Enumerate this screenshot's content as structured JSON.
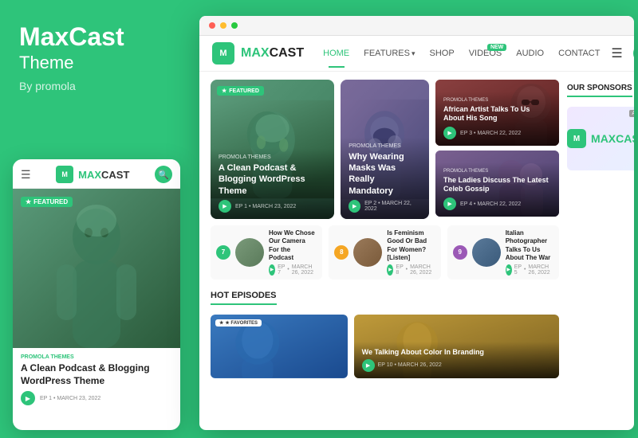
{
  "brand": {
    "name": "MaxCast",
    "subtitle": "Theme",
    "by": "By promola"
  },
  "nav": {
    "logo": "MAXCAST",
    "logo_max": "MAX",
    "logo_cast": "CAST",
    "links": [
      {
        "label": "HOME",
        "active": true
      },
      {
        "label": "FEATURES",
        "has_dropdown": true,
        "active": false
      },
      {
        "label": "SHOP",
        "active": false
      },
      {
        "label": "VIDEOS",
        "badge": "NEW",
        "active": false
      },
      {
        "label": "AUDIO",
        "active": false
      },
      {
        "label": "CONTACT",
        "active": false
      }
    ]
  },
  "featured_card1": {
    "tag": "PROMOLA THEMES",
    "title": "A Clean Podcast & Blogging WordPress Theme",
    "ep": "EP 1",
    "date": "MARCH 23, 2022",
    "badge": "FEATURED"
  },
  "featured_card2": {
    "tag": "PROMOLA THEMES",
    "title": "Why Wearing Masks Was Really Mandatory",
    "ep": "EP 2",
    "date": "MARCH 22, 2022"
  },
  "side_card1": {
    "tag": "PROMOLA THEMES",
    "title": "African Artist Talks To Us About His Song",
    "ep": "EP 3",
    "date": "MARCH 22, 2022"
  },
  "side_card2": {
    "tag": "PROMOLA THEMES",
    "title": "The Ladies Discuss The Latest Celeb Gossip",
    "ep": "EP 4",
    "date": "MARCH 22, 2022"
  },
  "ep_list": [
    {
      "num": "7",
      "title": "How We Chose Our Camera For the Podcast",
      "ep": "EP 7",
      "date": "MARCH 26, 2022",
      "color": "green"
    },
    {
      "num": "8",
      "title": "Is Feminism Good Or Bad For Women? [Listen]",
      "ep": "EP 8",
      "date": "MARCH 26, 2022",
      "color": "orange"
    },
    {
      "num": "9",
      "title": "Italian Photographer Talks To Us About The War",
      "ep": "EP 5",
      "date": "MARCH 26, 2022",
      "color": "purple"
    }
  ],
  "hot_episodes": {
    "label": "HOT EPISODES",
    "items": [
      {
        "badge": "★ FAVORITES",
        "title": "We Talking About Color In Branding",
        "ep": "EP 10",
        "date": "MARCH 26, 2022"
      }
    ]
  },
  "sponsors": {
    "label": "OUR SPONSORS",
    "ad_label": "AD",
    "logo_max": "MAX",
    "logo_cast": "CAST"
  },
  "mobile": {
    "tag": "PROMOLA THEMES",
    "title": "A Clean Podcast & Blogging WordPress Theme",
    "ep": "EP 1",
    "date": "MARCH 23, 2022",
    "badge": "FEATURED"
  },
  "dots": {
    "red": "#ff5f56",
    "yellow": "#ffbd2e",
    "green": "#27c93f"
  }
}
